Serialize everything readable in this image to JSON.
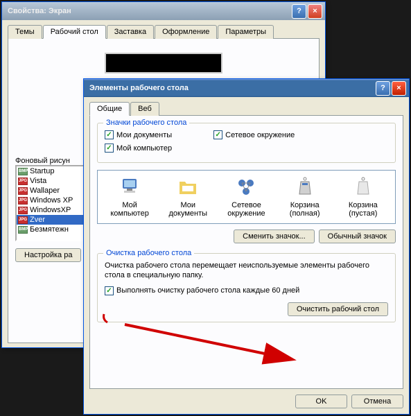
{
  "win1": {
    "title": "Свойства: Экран",
    "tabs": [
      "Темы",
      "Рабочий стол",
      "Заставка",
      "Оформление",
      "Параметры"
    ],
    "active_tab": 1,
    "bg_label": "Фоновый рисун",
    "files": [
      {
        "type": "bmp",
        "name": "Startup"
      },
      {
        "type": "jpg",
        "name": "Vista"
      },
      {
        "type": "jpg",
        "name": "Wallaper"
      },
      {
        "type": "jpg",
        "name": "Windows XP"
      },
      {
        "type": "jpg",
        "name": "WindowsXP"
      },
      {
        "type": "jpg",
        "name": "Zver"
      },
      {
        "type": "bmp",
        "name": "Безмятежн"
      }
    ],
    "selected_file_index": 5,
    "customize_btn": "Настройка ра"
  },
  "win2": {
    "title": "Элементы рабочего стола",
    "tabs": [
      "Общие",
      "Веб"
    ],
    "active_tab": 0,
    "icons_group": "Значки рабочего стола",
    "chk_mydocs": "Мои документы",
    "chk_network": "Сетевое окружение",
    "chk_mycomp": "Мой компьютер",
    "icons": [
      {
        "name": "Мой компьютер"
      },
      {
        "name": "Мои документы"
      },
      {
        "name": "Сетевое окружение"
      },
      {
        "name": "Корзина (полная)"
      },
      {
        "name": "Корзина (пустая)"
      }
    ],
    "change_icon_btn": "Сменить значок...",
    "default_icon_btn": "Обычный значок",
    "cleanup_group": "Очистка рабочего стола",
    "cleanup_desc": "Очистка рабочего стола перемещает неиспользуемые элементы рабочего стола в специальную папку.",
    "chk_cleanup": "Выполнять очистку рабочего стола каждые 60 дней",
    "cleanup_btn": "Очистить рабочий стол",
    "ok_btn": "OK",
    "cancel_btn": "Отмена"
  }
}
